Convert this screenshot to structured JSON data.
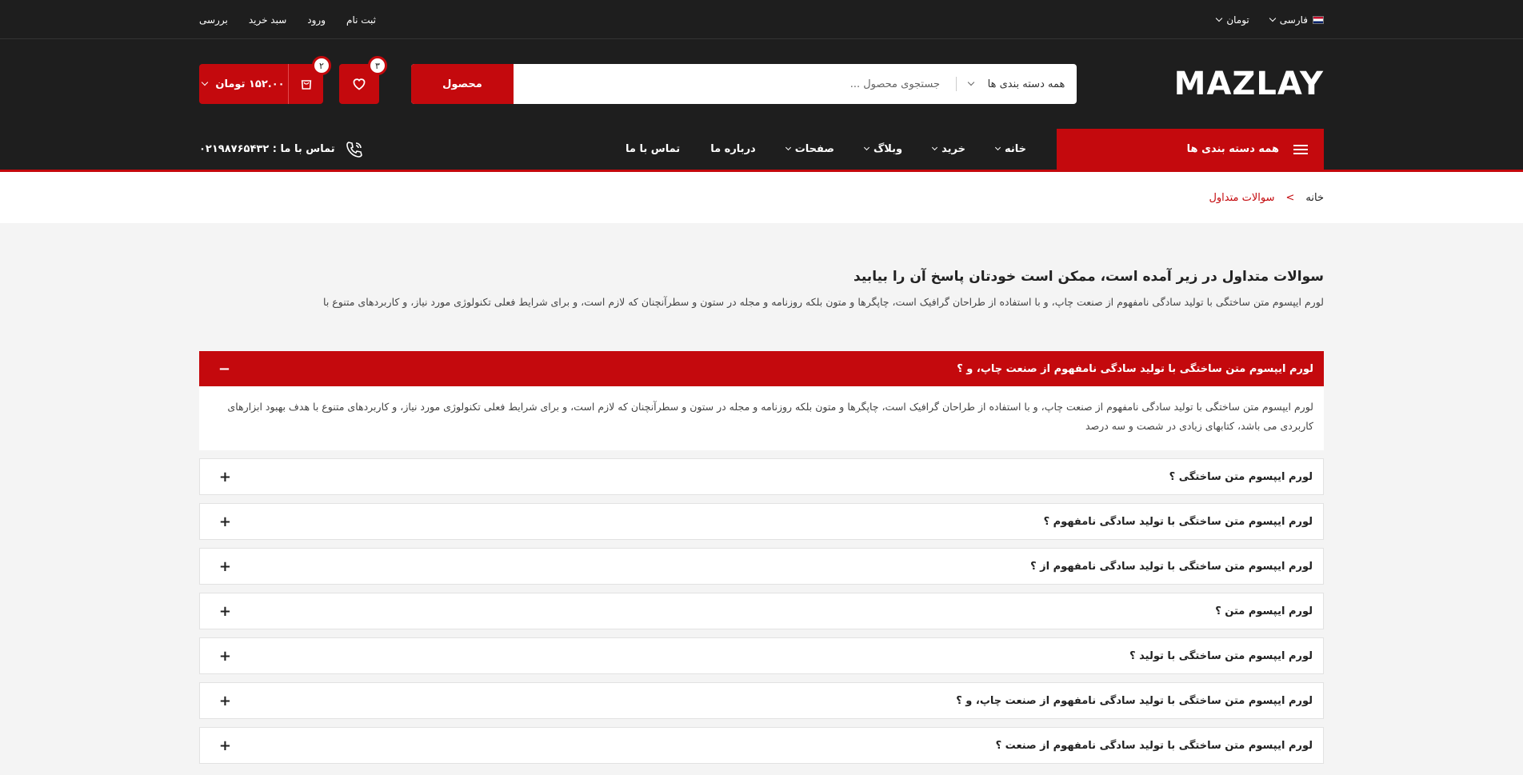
{
  "topbar": {
    "language": "فارسی",
    "currency": "تومان",
    "links": [
      "ثبت نام",
      "ورود",
      "سبد خرید",
      "بررسی"
    ]
  },
  "header": {
    "logo_text": "MAZLAY",
    "search": {
      "category": "همه دسته بندی ها",
      "placeholder": "جستجوی محصول ...",
      "button": "محصول"
    },
    "wishlist_count": "۳",
    "cart_count": "۲",
    "cart_total": "۱۵۲.۰۰ تومان"
  },
  "nav": {
    "all_categories": "همه دسته بندی ها",
    "items": [
      {
        "label": "خانه",
        "has_dropdown": true
      },
      {
        "label": "خرید",
        "has_dropdown": true
      },
      {
        "label": "وبلاگ",
        "has_dropdown": true
      },
      {
        "label": "صفحات",
        "has_dropdown": true
      },
      {
        "label": "درباره ما",
        "has_dropdown": false
      },
      {
        "label": "تماس با ما",
        "has_dropdown": false
      }
    ],
    "contact": "تماس با ما : ۰۲۱۹۸۷۶۵۴۳۲"
  },
  "breadcrumb": {
    "home": "خانه",
    "separator": ">",
    "current": "سوالات متداول"
  },
  "intro": {
    "title": "سوالات متداول در زیر آمده است، ممکن است خودتان پاسخ آن را بیابید",
    "text": "لورم ایپسوم متن ساختگی با تولید سادگی نامفهوم از صنعت چاپ، و با استفاده از طراحان گرافیک است، چاپگرها و متون بلکه روزنامه و مجله در ستون و سطرآنچنان که لازم است، و برای شرایط فعلی تکنولوژی مورد نیاز، و کاربردهای متنوع با"
  },
  "faq": [
    {
      "question": "لورم ایپسوم متن ساختگی با تولید سادگی نامفهوم از صنعت چاپ، و ؟",
      "open": true,
      "sign": "−",
      "answer": "لورم ایپسوم متن ساختگی با تولید سادگی نامفهوم از صنعت چاپ، و با استفاده از طراحان گرافیک است، چاپگرها و متون بلکه روزنامه و مجله در ستون و سطرآنچنان که لازم است، و برای شرایط فعلی تکنولوژی مورد نیاز، و کاربردهای متنوع با هدف بهبود ابزارهای کاربردی می باشد، کتابهای زیادی در شصت و سه درصد"
    },
    {
      "question": "لورم ایپسوم متن ساختگی ؟",
      "open": false,
      "sign": "+"
    },
    {
      "question": "لورم ایپسوم متن ساختگی با تولید سادگی نامفهوم ؟",
      "open": false,
      "sign": "+"
    },
    {
      "question": "لورم ایپسوم متن ساختگی با تولید سادگی نامفهوم از ؟",
      "open": false,
      "sign": "+"
    },
    {
      "question": "لورم ایپسوم متن ؟",
      "open": false,
      "sign": "+"
    },
    {
      "question": "لورم ایپسوم متن ساختگی با تولید ؟",
      "open": false,
      "sign": "+"
    },
    {
      "question": "لورم ایپسوم متن ساختگی با تولید سادگی نامفهوم از صنعت چاپ، و ؟",
      "open": false,
      "sign": "+"
    },
    {
      "question": "لورم ایپسوم متن ساختگی با تولید سادگی نامفهوم از صنعت ؟",
      "open": false,
      "sign": "+"
    }
  ],
  "colors": {
    "accent": "#c4090d",
    "dark": "#1e1e1e",
    "page_bg": "#f4f4f4"
  }
}
